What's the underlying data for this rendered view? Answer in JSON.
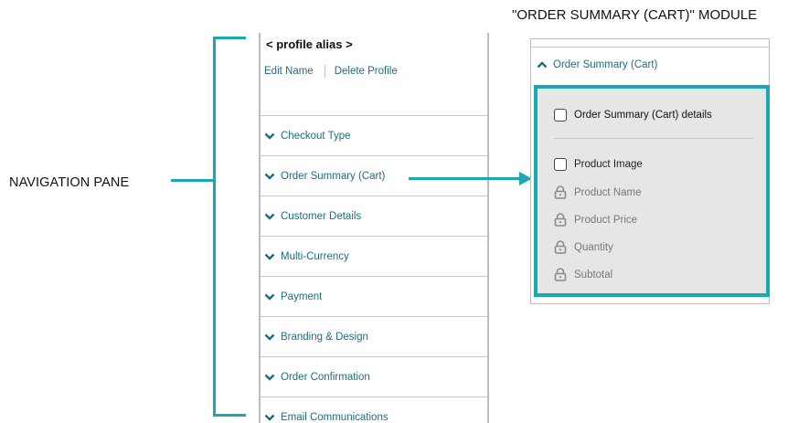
{
  "labels": {
    "navigation_pane": "NAVIGATION PANE",
    "module_title": "\"ORDER SUMMARY (CART)\" MODULE"
  },
  "colors": {
    "accent": "#1aa8b5",
    "link": "#1a6e80",
    "panel_bg": "#e6e6e6"
  },
  "nav": {
    "profile_alias": "< profile alias >",
    "edit_name": "Edit Name",
    "delete_profile": "Delete Profile",
    "items": [
      {
        "label": "Checkout Type",
        "icon": "chevron-down-icon"
      },
      {
        "label": "Order Summary (Cart)",
        "icon": "chevron-down-icon"
      },
      {
        "label": "Customer Details",
        "icon": "chevron-down-icon"
      },
      {
        "label": "Multi-Currency",
        "icon": "chevron-down-icon"
      },
      {
        "label": "Payment",
        "icon": "chevron-down-icon"
      },
      {
        "label": "Branding & Design",
        "icon": "chevron-down-icon"
      },
      {
        "label": "Order Confirmation",
        "icon": "chevron-down-icon"
      },
      {
        "label": "Email Communications",
        "icon": "chevron-down-icon"
      }
    ]
  },
  "module": {
    "header": "Order Summary (Cart)",
    "header_icon": "chevron-up-icon",
    "details_label": "Order Summary (Cart) details",
    "fields": [
      {
        "label": "Product Image",
        "control": "checkbox"
      },
      {
        "label": "Product Name",
        "control": "lock-icon"
      },
      {
        "label": "Product Price",
        "control": "lock-icon"
      },
      {
        "label": "Quantity",
        "control": "lock-icon"
      },
      {
        "label": "Subtotal",
        "control": "lock-icon"
      }
    ]
  }
}
